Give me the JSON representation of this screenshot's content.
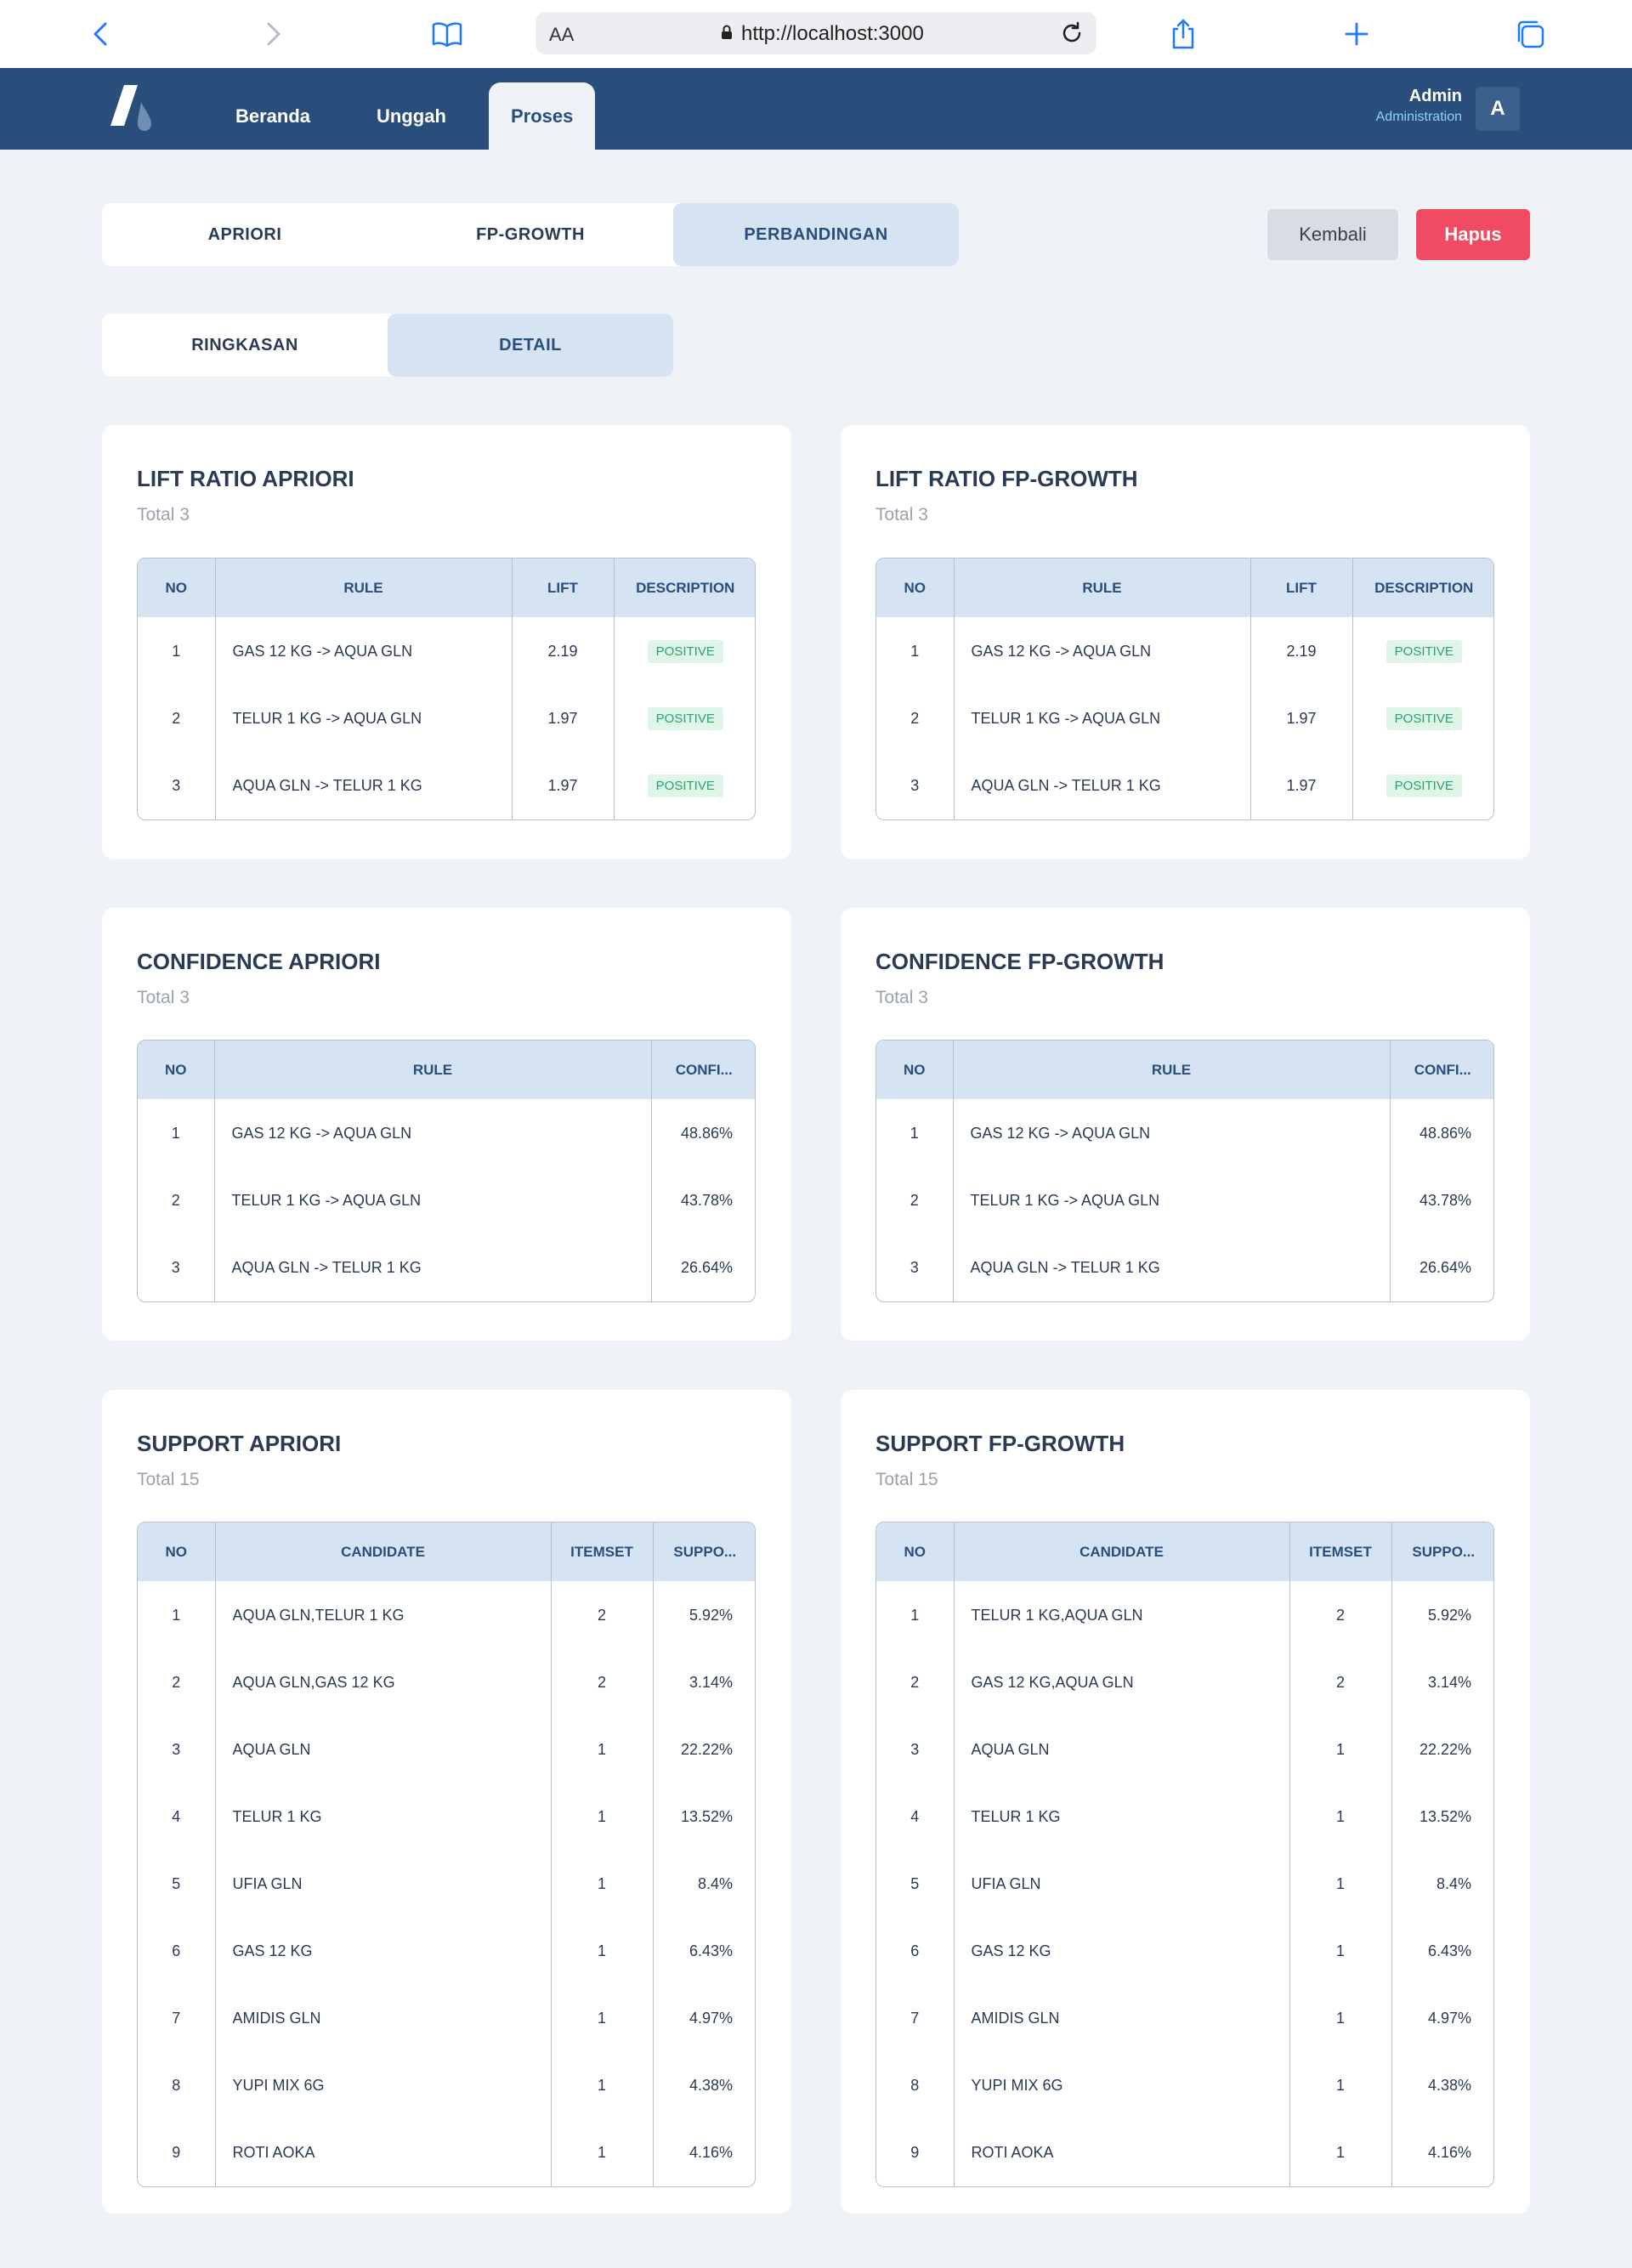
{
  "browser": {
    "url_aa": "AA",
    "url": "http://localhost:3000"
  },
  "header": {
    "nav": [
      "Beranda",
      "Unggah",
      "Proses"
    ],
    "active_nav": "Proses",
    "user_name": "Admin",
    "user_role": "Administration",
    "avatar_initial": "A"
  },
  "main_tabs": [
    "APRIORI",
    "FP-GROWTH",
    "PERBANDINGAN"
  ],
  "active_main_tab": "PERBANDINGAN",
  "sub_tabs": [
    "RINGKASAN",
    "DETAIL"
  ],
  "active_sub_tab": "DETAIL",
  "buttons": {
    "back": "Kembali",
    "delete": "Hapus"
  },
  "lift_apriori": {
    "title": "LIFT RATIO APRIORI",
    "total": "Total 3",
    "headers": [
      "NO",
      "RULE",
      "LIFT",
      "DESCRIPTION"
    ],
    "rows": [
      [
        "1",
        "GAS 12 KG -> AQUA GLN",
        "2.19",
        "POSITIVE"
      ],
      [
        "2",
        "TELUR 1 KG -> AQUA GLN",
        "1.97",
        "POSITIVE"
      ],
      [
        "3",
        "AQUA GLN -> TELUR 1 KG",
        "1.97",
        "POSITIVE"
      ]
    ]
  },
  "lift_fpgrowth": {
    "title": "LIFT RATIO FP-GROWTH",
    "total": "Total 3",
    "headers": [
      "NO",
      "RULE",
      "LIFT",
      "DESCRIPTION"
    ],
    "rows": [
      [
        "1",
        "GAS 12 KG -> AQUA GLN",
        "2.19",
        "POSITIVE"
      ],
      [
        "2",
        "TELUR 1 KG -> AQUA GLN",
        "1.97",
        "POSITIVE"
      ],
      [
        "3",
        "AQUA GLN -> TELUR 1 KG",
        "1.97",
        "POSITIVE"
      ]
    ]
  },
  "conf_apriori": {
    "title": "CONFIDENCE APRIORI",
    "total": "Total 3",
    "headers": [
      "NO",
      "RULE",
      "CONFI..."
    ],
    "rows": [
      [
        "1",
        "GAS 12 KG -> AQUA GLN",
        "48.86%"
      ],
      [
        "2",
        "TELUR 1 KG -> AQUA GLN",
        "43.78%"
      ],
      [
        "3",
        "AQUA GLN -> TELUR 1 KG",
        "26.64%"
      ]
    ]
  },
  "conf_fpgrowth": {
    "title": "CONFIDENCE FP-GROWTH",
    "total": "Total 3",
    "headers": [
      "NO",
      "RULE",
      "CONFI..."
    ],
    "rows": [
      [
        "1",
        "GAS 12 KG -> AQUA GLN",
        "48.86%"
      ],
      [
        "2",
        "TELUR 1 KG -> AQUA GLN",
        "43.78%"
      ],
      [
        "3",
        "AQUA GLN -> TELUR 1 KG",
        "26.64%"
      ]
    ]
  },
  "supp_apriori": {
    "title": "SUPPORT APRIORI",
    "total": "Total 15",
    "headers": [
      "NO",
      "CANDIDATE",
      "ITEMSET",
      "SUPPO..."
    ],
    "rows": [
      [
        "1",
        "AQUA GLN,TELUR 1 KG",
        "2",
        "5.92%"
      ],
      [
        "2",
        "AQUA GLN,GAS 12 KG",
        "2",
        "3.14%"
      ],
      [
        "3",
        "AQUA GLN",
        "1",
        "22.22%"
      ],
      [
        "4",
        "TELUR 1 KG",
        "1",
        "13.52%"
      ],
      [
        "5",
        "UFIA GLN",
        "1",
        "8.4%"
      ],
      [
        "6",
        "GAS 12 KG",
        "1",
        "6.43%"
      ],
      [
        "7",
        "AMIDIS GLN",
        "1",
        "4.97%"
      ],
      [
        "8",
        "YUPI MIX 6G",
        "1",
        "4.38%"
      ],
      [
        "9",
        "ROTI AOKA",
        "1",
        "4.16%"
      ]
    ]
  },
  "supp_fpgrowth": {
    "title": "SUPPORT FP-GROWTH",
    "total": "Total 15",
    "headers": [
      "NO",
      "CANDIDATE",
      "ITEMSET",
      "SUPPO..."
    ],
    "rows": [
      [
        "1",
        "TELUR 1 KG,AQUA GLN",
        "2",
        "5.92%"
      ],
      [
        "2",
        "GAS 12 KG,AQUA GLN",
        "2",
        "3.14%"
      ],
      [
        "3",
        "AQUA GLN",
        "1",
        "22.22%"
      ],
      [
        "4",
        "TELUR 1 KG",
        "1",
        "13.52%"
      ],
      [
        "5",
        "UFIA GLN",
        "1",
        "8.4%"
      ],
      [
        "6",
        "GAS 12 KG",
        "1",
        "6.43%"
      ],
      [
        "7",
        "AMIDIS GLN",
        "1",
        "4.97%"
      ],
      [
        "8",
        "YUPI MIX 6G",
        "1",
        "4.38%"
      ],
      [
        "9",
        "ROTI AOKA",
        "1",
        "4.16%"
      ]
    ]
  }
}
